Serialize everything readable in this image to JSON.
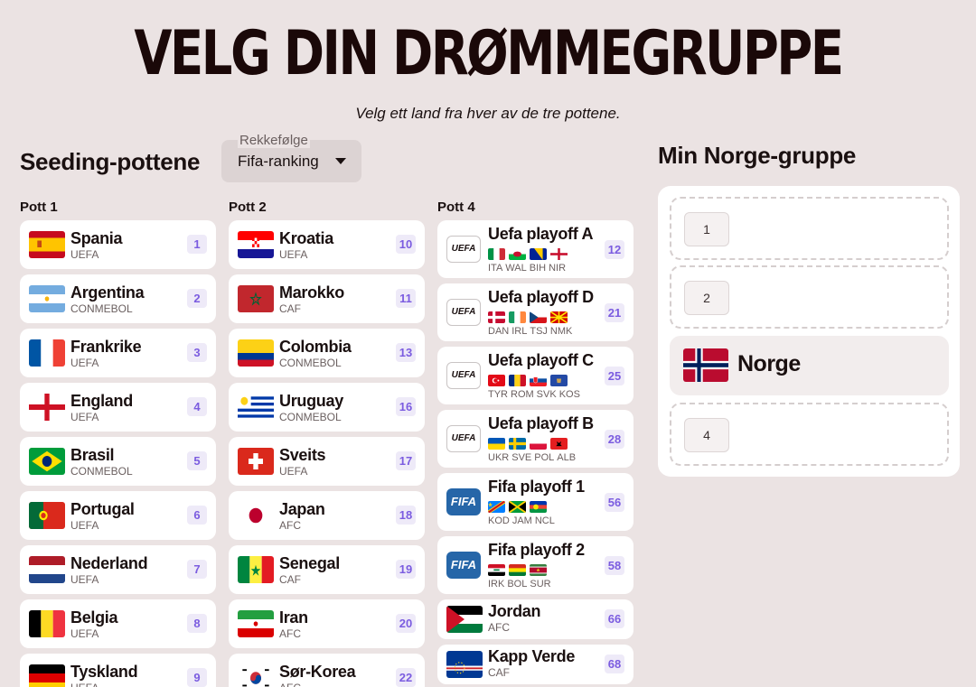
{
  "header": {
    "title": "VELG DIN DRØMMEGRUPPE",
    "subtitle": "Velg ett land fra hver av de tre pottene."
  },
  "seeding": {
    "title": "Seeding-pottene",
    "sort": {
      "label": "Rekkefølge",
      "value": "Fifa-ranking",
      "icon": "caret-down-icon"
    }
  },
  "pots": [
    {
      "title": "Pott 1",
      "teams": [
        {
          "name": "Spania",
          "conf": "UEFA",
          "rank": "1",
          "flag": "spain"
        },
        {
          "name": "Argentina",
          "conf": "CONMEBOL",
          "rank": "2",
          "flag": "argentina"
        },
        {
          "name": "Frankrike",
          "conf": "UEFA",
          "rank": "3",
          "flag": "france"
        },
        {
          "name": "England",
          "conf": "UEFA",
          "rank": "4",
          "flag": "england"
        },
        {
          "name": "Brasil",
          "conf": "CONMEBOL",
          "rank": "5",
          "flag": "brazil"
        },
        {
          "name": "Portugal",
          "conf": "UEFA",
          "rank": "6",
          "flag": "portugal"
        },
        {
          "name": "Nederland",
          "conf": "UEFA",
          "rank": "7",
          "flag": "netherlands"
        },
        {
          "name": "Belgia",
          "conf": "UEFA",
          "rank": "8",
          "flag": "belgium"
        },
        {
          "name": "Tyskland",
          "conf": "UEFA",
          "rank": "9",
          "flag": "germany"
        }
      ]
    },
    {
      "title": "Pott 2",
      "teams": [
        {
          "name": "Kroatia",
          "conf": "UEFA",
          "rank": "10",
          "flag": "croatia"
        },
        {
          "name": "Marokko",
          "conf": "CAF",
          "rank": "11",
          "flag": "morocco"
        },
        {
          "name": "Colombia",
          "conf": "CONMEBOL",
          "rank": "13",
          "flag": "colombia"
        },
        {
          "name": "Uruguay",
          "conf": "CONMEBOL",
          "rank": "16",
          "flag": "uruguay"
        },
        {
          "name": "Sveits",
          "conf": "UEFA",
          "rank": "17",
          "flag": "switzerland"
        },
        {
          "name": "Japan",
          "conf": "AFC",
          "rank": "18",
          "flag": "japan"
        },
        {
          "name": "Senegal",
          "conf": "CAF",
          "rank": "19",
          "flag": "senegal"
        },
        {
          "name": "Iran",
          "conf": "AFC",
          "rank": "20",
          "flag": "iran"
        },
        {
          "name": "Sør-Korea",
          "conf": "AFC",
          "rank": "22",
          "flag": "korea"
        }
      ]
    },
    {
      "title": "Pott 4",
      "teams": [
        {
          "name": "Uefa playoff A",
          "logo": "UEFA",
          "rank": "12",
          "codes": [
            "ITA",
            "WAL",
            "BIH",
            "NIR"
          ],
          "minis": [
            "italy",
            "wales",
            "bosnia",
            "nireland"
          ]
        },
        {
          "name": "Uefa playoff D",
          "logo": "UEFA",
          "rank": "21",
          "codes": [
            "DAN",
            "IRL",
            "TSJ",
            "NMK"
          ],
          "minis": [
            "denmark",
            "ireland",
            "czech",
            "macedonia"
          ]
        },
        {
          "name": "Uefa playoff C",
          "logo": "UEFA",
          "rank": "25",
          "codes": [
            "TYR",
            "ROM",
            "SVK",
            "KOS"
          ],
          "minis": [
            "turkey",
            "romania",
            "slovakia",
            "kosovo"
          ]
        },
        {
          "name": "Uefa playoff B",
          "logo": "UEFA",
          "rank": "28",
          "codes": [
            "UKR",
            "SVE",
            "POL",
            "ALB"
          ],
          "minis": [
            "ukraine",
            "sweden",
            "poland",
            "albania"
          ]
        },
        {
          "name": "Fifa playoff 1",
          "logo": "FIFA",
          "rank": "56",
          "codes": [
            "KOD",
            "JAM",
            "NCL"
          ],
          "minis": [
            "drcongo",
            "jamaica",
            "newcaledonia"
          ]
        },
        {
          "name": "Fifa playoff 2",
          "logo": "FIFA",
          "rank": "58",
          "codes": [
            "IRK",
            "BOL",
            "SUR"
          ],
          "minis": [
            "iraq",
            "bolivia",
            "suriname"
          ]
        },
        {
          "name": "Jordan",
          "conf": "AFC",
          "rank": "66",
          "flag": "jordan"
        },
        {
          "name": "Kapp Verde",
          "conf": "CAF",
          "rank": "68",
          "flag": "capeverde"
        }
      ]
    }
  ],
  "group": {
    "title": "Min Norge-gruppe",
    "slots": [
      {
        "label": "1"
      },
      {
        "label": "2"
      },
      {
        "team": "Norge",
        "flag": "norway"
      },
      {
        "label": "4"
      }
    ]
  },
  "colors": {
    "background": "#ebe3e3",
    "rank_text": "#7b5ce0",
    "rank_bg": "#eeeaf8",
    "fifa_logo": "#2666a8"
  }
}
